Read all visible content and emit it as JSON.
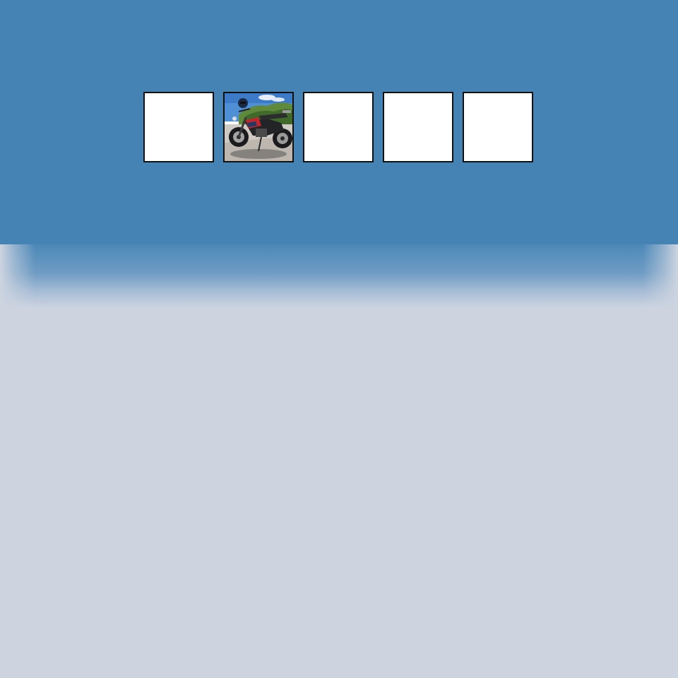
{
  "page": {
    "background_color": "#cdd4e0",
    "header_color": "#4583b4"
  },
  "thumbnails": [
    {
      "content": "empty"
    },
    {
      "content": "motorcycle-photo"
    },
    {
      "content": "empty"
    },
    {
      "content": "empty"
    },
    {
      "content": "empty"
    }
  ]
}
